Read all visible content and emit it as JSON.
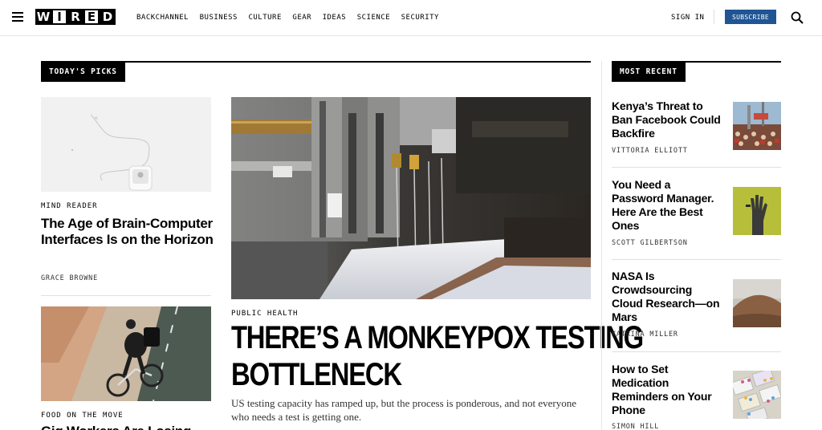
{
  "header": {
    "logo_letters": [
      "W",
      "I",
      "R",
      "E",
      "D"
    ],
    "nav": [
      "Backchannel",
      "Business",
      "Culture",
      "Gear",
      "Ideas",
      "Science",
      "Security"
    ],
    "signin_label": "SIGN IN",
    "subscribe_label": "SUBSCRIBE"
  },
  "picks": {
    "label": "TODAY'S PICKS",
    "story1": {
      "rubric": "MIND READER",
      "title": "The Age of Brain-Computer Interfaces Is on the Horizon",
      "byline": "GRACE BROWNE"
    },
    "story2": {
      "rubric": "FOOD ON THE MOVE",
      "title": "Gig Workers Are Losing"
    },
    "feature": {
      "rubric": "PUBLIC HEALTH",
      "title_line1": "There’s a Monkeypox Testing",
      "title_line2": "Bottleneck",
      "dek": "US testing capacity has ramped up, but the process is ponderous, and not everyone who needs a test is getting one."
    }
  },
  "recent": {
    "label": "MOST RECENT",
    "items": [
      {
        "title": "Kenya’s Threat to Ban Facebook Could Backfire",
        "byline": "VITTORIA ELLIOTT"
      },
      {
        "title": "You Need a Password Manager. Here Are the Best Ones",
        "byline": "SCOTT GILBERTSON"
      },
      {
        "title": "NASA Is Crowdsourcing Cloud Research—on Mars",
        "byline": "KATRINA MILLER"
      },
      {
        "title": "How to Set Medication Reminders on Your Phone",
        "byline": "SIMON HILL"
      }
    ]
  },
  "colors": {
    "subscribe_bg": "#1f5593",
    "accent": "#000000"
  }
}
